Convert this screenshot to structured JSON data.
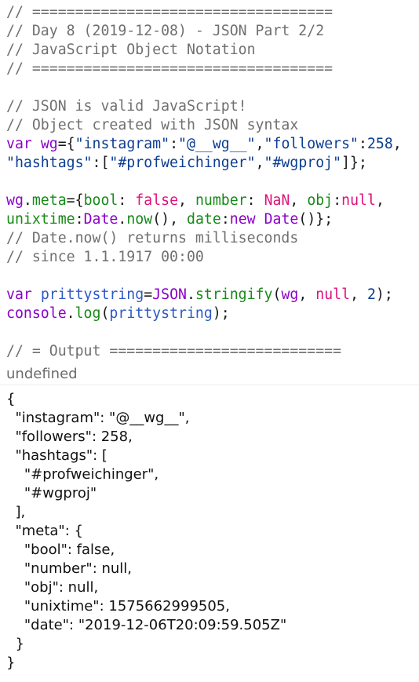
{
  "code_lines": [
    "// ===================================",
    "// Day 8 (2019-12-08) - JSON Part 2/2",
    "// JavaScript Object Notation",
    "// ===================================",
    "",
    "// JSON is valid JavaScript!",
    "// Object created with JSON syntax",
    "var wg={\"instagram\":\"@__wg__\",\"followers\":258,",
    "\"hashtags\":[\"#profweichinger\",\"#wgproj\"]};",
    "",
    "wg.meta={bool: false, number: NaN, obj:null,",
    "unixtime:Date.now(), date:new Date()};",
    "// Date.now() returns milliseconds",
    "// since 1.1.1917 00:00",
    "",
    "var prittystring=JSON.stringify(wg, null, 2);",
    "console.log(prittystring);",
    "",
    "// = Output ==========================="
  ],
  "output_label": "undefined",
  "output_lines": [
    "{",
    "  \"instagram\": \"@__wg__\",",
    "  \"followers\": 258,",
    "  \"hashtags\": [",
    "    \"#profweichinger\",",
    "    \"#wgproj\"",
    "  ],",
    "  \"meta\": {",
    "    \"bool\": false,",
    "    \"number\": null,",
    "    \"obj\": null,",
    "    \"unixtime\": 1575662999505,",
    "    \"date\": \"2019-12-06T20:09:59.505Z\"",
    "  }",
    "}"
  ],
  "colors": {
    "comment": "#707070",
    "keyword": "#8b00c9",
    "string": "#0b3d91",
    "property": "#178a17",
    "constant": "#e0127b"
  }
}
